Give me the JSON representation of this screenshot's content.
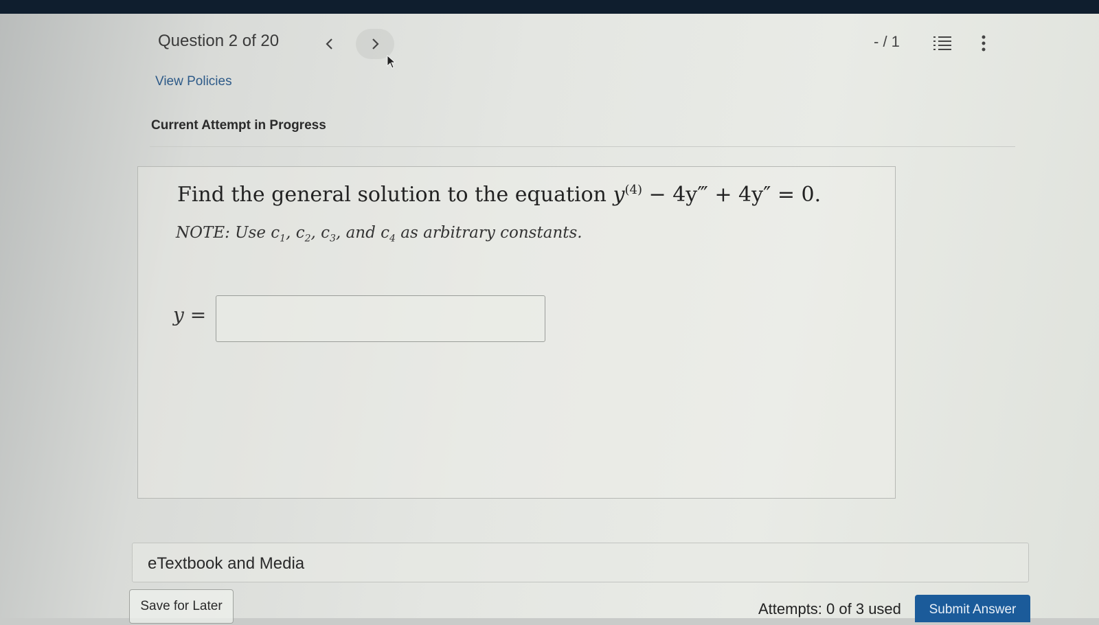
{
  "header": {
    "question_label": "Question 2 of 20",
    "prev_icon": "chevron-left-icon",
    "next_icon": "chevron-right-icon",
    "score": "- / 1",
    "list_icon": "question-list-icon",
    "more_icon": "more-vertical-icon"
  },
  "links": {
    "view_policies": "View Policies"
  },
  "attempt": {
    "status": "Current Attempt in Progress"
  },
  "question": {
    "prefix": "Find the general solution to the equation ",
    "eq_y1": "y",
    "eq_sup": "(4)",
    "eq_rest": " − 4y‴ + 4y″ = 0.",
    "note_prefix": "NOTE: Use ",
    "c": "c",
    "s1": "1",
    "s2": "2",
    "s3": "3",
    "s4": "4",
    "comma": ", ",
    "and": ", and ",
    "note_suffix": " as arbitrary constants.",
    "answer_label": "y =",
    "answer_value": ""
  },
  "resources": {
    "etextbook": "eTextbook and Media"
  },
  "footer": {
    "save_label": "Save for Later",
    "attempts_text": "Attempts: 0 of 3 used",
    "submit_label": "Submit Answer"
  },
  "colors": {
    "link": "#2d5a88",
    "submit_bg": "#1b5b9a",
    "topbar": "#0f1e2e"
  }
}
